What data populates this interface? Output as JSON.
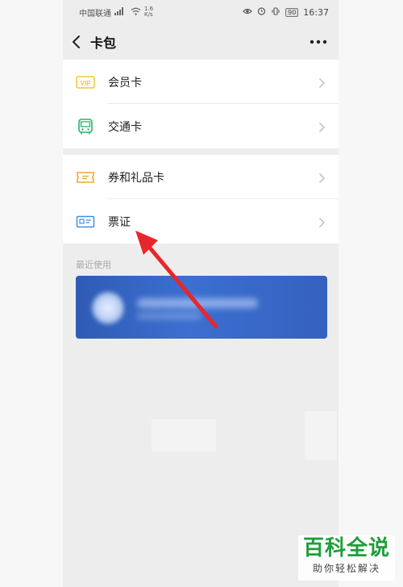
{
  "status_bar": {
    "carrier": "中国联通",
    "signal": "⁴ᴳ",
    "net_speed": "1.6\nK/s",
    "battery": "90",
    "time": "16:37"
  },
  "navbar": {
    "title": "卡包",
    "back_icon": "chevron-left-icon",
    "more_icon": "more-dots-icon"
  },
  "groups": [
    {
      "items": [
        {
          "label": "会员卡",
          "icon": "vip-card-icon",
          "color": "#f2c530"
        },
        {
          "label": "交通卡",
          "icon": "bus-icon",
          "color": "#29b36a"
        }
      ]
    },
    {
      "items": [
        {
          "label": "券和礼品卡",
          "icon": "coupon-icon",
          "color": "#f0a23c"
        },
        {
          "label": "票证",
          "icon": "ticket-id-icon",
          "color": "#3b8fe0"
        }
      ]
    }
  ],
  "recent": {
    "label": "最近使用"
  },
  "annotation": {
    "arrow_color": "#e8262b"
  },
  "watermark": {
    "title": "百科全说",
    "subtitle": "助你轻松解决"
  }
}
